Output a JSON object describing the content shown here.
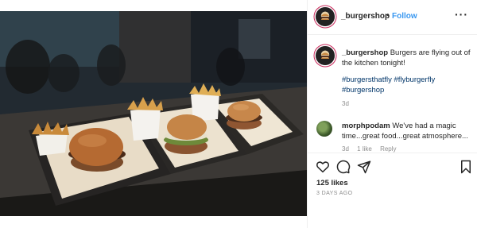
{
  "header": {
    "username": "_burgershop",
    "dot": "•",
    "follow_label": "Follow",
    "more_label": "···"
  },
  "caption": {
    "username": "_burgershop",
    "text": "Burgers are flying out of the kitchen tonight!",
    "hashtags": "#burgersthatfly #flyburgerfly #burgershop",
    "time": "3d"
  },
  "comment": {
    "username": "morphpodam",
    "text": "We've had a magic time...great food...great atmosphere...",
    "time": "3d",
    "likes": "1 like",
    "reply": "Reply"
  },
  "actions": {
    "like_icon": "heart-icon",
    "comment_icon": "comment-bubble-icon",
    "share_icon": "paper-plane-icon",
    "save_icon": "bookmark-icon"
  },
  "stats": {
    "likes": "125 likes",
    "date": "3 DAYS AGO"
  },
  "colors": {
    "link": "#3897f0",
    "hashtag": "#003569",
    "muted": "#8e8e8e",
    "story_ring": "#c9275a"
  }
}
